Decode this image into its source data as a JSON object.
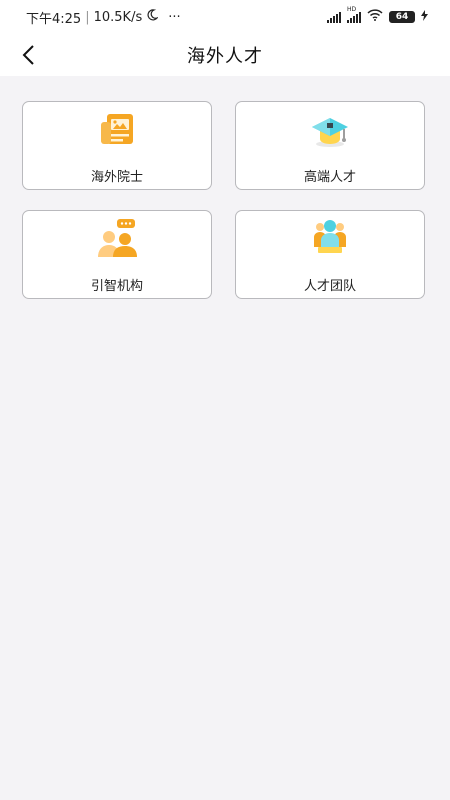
{
  "status_bar": {
    "time": "下午4:25",
    "speed": "10.5K/s",
    "separator": "|",
    "more": "···",
    "network_label": "HD",
    "battery": "64"
  },
  "header": {
    "title": "海外人才"
  },
  "cards": [
    {
      "label": "海外院士",
      "icon": "newspaper-icon"
    },
    {
      "label": "高端人才",
      "icon": "graduation-cap-icon"
    },
    {
      "label": "引智机构",
      "icon": "people-chat-icon"
    },
    {
      "label": "人才团队",
      "icon": "team-icon"
    }
  ],
  "colors": {
    "accent_orange": "#f5a623",
    "accent_yellow": "#ffd54f",
    "accent_teal": "#4dd0e1",
    "background": "#f4f3f6"
  }
}
